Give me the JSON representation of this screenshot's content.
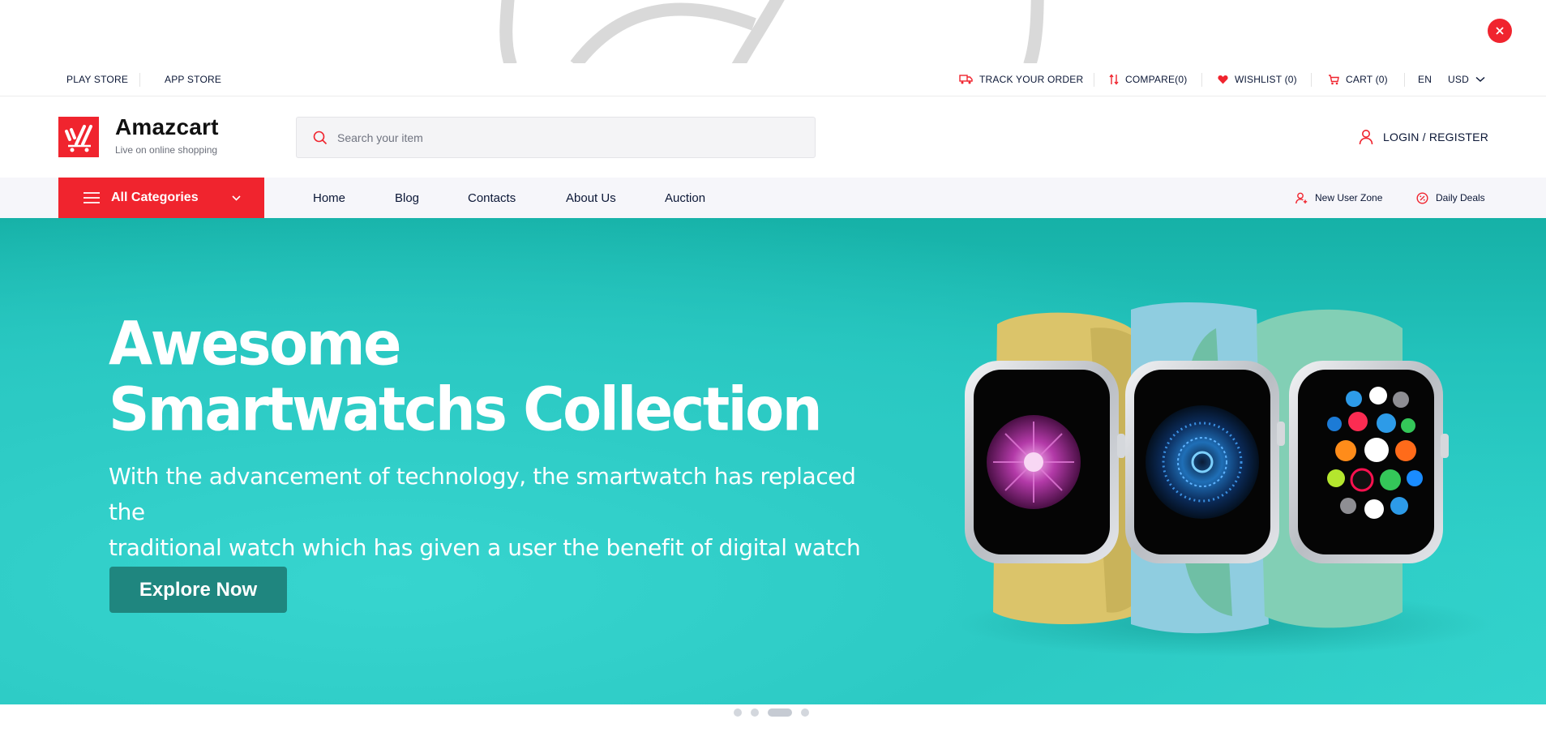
{
  "promo": {
    "close_label": "×"
  },
  "topbar": {
    "play_store": "PLAY STORE",
    "app_store": "APP STORE",
    "track_order": "TRACK YOUR ORDER",
    "compare": "COMPARE(0)",
    "wishlist": "WISHLIST (0)",
    "cart": "CART (0)",
    "language": "EN",
    "currency": "USD"
  },
  "header": {
    "logo_title": "Amazcart",
    "logo_subtitle": "Live on online shopping",
    "search_placeholder": "Search your item",
    "login_register": "LOGIN / REGISTER"
  },
  "nav": {
    "all_categories": "All Categories",
    "links": [
      "Home",
      "Blog",
      "Contacts",
      "About Us",
      "Auction"
    ],
    "new_user_zone": "New User Zone",
    "daily_deals": "Daily Deals"
  },
  "hero": {
    "title_line1": "Awesome",
    "title_line2": "Smartwatchs Collection",
    "desc_line1": "With the advancement of technology, the smartwatch has replaced the",
    "desc_line2": "traditional watch which has given a user the benefit of digital watch",
    "cta": "Explore Now"
  },
  "slider": {
    "total": 4,
    "active_index": 2
  },
  "colors": {
    "brand_red": "#f0242e",
    "navy": "#0b1736",
    "teal": "#2cc9c2",
    "cta": "#1f867f"
  }
}
